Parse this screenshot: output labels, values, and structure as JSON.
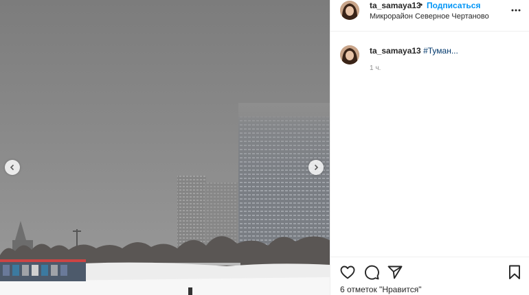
{
  "post": {
    "author": {
      "username": "ta_samaya13",
      "follow_label": "Подписаться",
      "separator": "•",
      "location": "Микрорайон Северное Чертаново"
    },
    "caption": {
      "username": "ta_samaya13",
      "hashtag": "#Туман...",
      "time": "1 ч."
    },
    "likes_text": "6 отметок \"Нравится\"",
    "icons": {
      "more": "more-options-icon",
      "prev": "chevron-left-icon",
      "next": "chevron-right-icon",
      "like": "heart-icon",
      "comment": "comment-icon",
      "share": "paper-plane-icon",
      "save": "bookmark-icon"
    },
    "colors": {
      "follow": "#0095f6",
      "hashtag": "#00376b",
      "text": "#262626",
      "muted": "#8e8e8e"
    }
  }
}
